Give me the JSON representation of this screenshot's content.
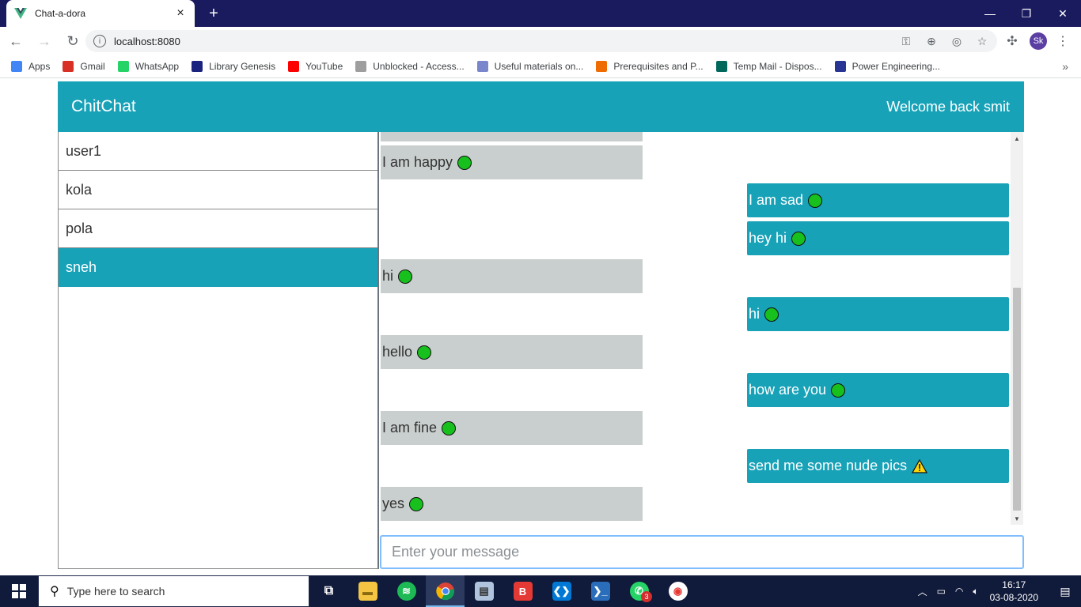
{
  "browser": {
    "tab_title": "Chat-a-dora",
    "url": "localhost:8080",
    "profile_initials": "Sk"
  },
  "bookmarks": [
    {
      "label": "Apps",
      "icon": "apps-grid-icon",
      "color": "#4285f4"
    },
    {
      "label": "Gmail",
      "icon": "gmail-icon",
      "color": "#d93025"
    },
    {
      "label": "WhatsApp",
      "icon": "whatsapp-icon",
      "color": "#25d366"
    },
    {
      "label": "Library Genesis",
      "icon": "library-icon",
      "color": "#1a237e"
    },
    {
      "label": "YouTube",
      "icon": "youtube-icon",
      "color": "#ff0000"
    },
    {
      "label": "Unblocked - Access...",
      "icon": "unblocked-icon",
      "color": "#9e9e9e"
    },
    {
      "label": "Useful materials on...",
      "icon": "materials-icon",
      "color": "#7986cb"
    },
    {
      "label": "Prerequisites and P...",
      "icon": "code-icon",
      "color": "#ef6c00"
    },
    {
      "label": "Temp Mail - Dispos...",
      "icon": "tempmail-icon",
      "color": "#00695c"
    },
    {
      "label": "Power Engineering...",
      "icon": "power-eng-icon",
      "color": "#283593"
    }
  ],
  "app": {
    "brand": "ChitChat",
    "welcome": "Welcome back smit",
    "accent_color": "#17a2b8",
    "users": [
      {
        "name": "user1",
        "active": false
      },
      {
        "name": "kola",
        "active": false
      },
      {
        "name": "pola",
        "active": false
      },
      {
        "name": "sneh",
        "active": true
      }
    ],
    "messages": [
      {
        "text": "I am happy",
        "direction": "received",
        "status": "ok"
      },
      {
        "text": "I am sad",
        "direction": "sent",
        "status": "ok"
      },
      {
        "text": "hey hi",
        "direction": "sent",
        "status": "ok"
      },
      {
        "text": "hi",
        "direction": "received",
        "status": "ok"
      },
      {
        "text": "hi",
        "direction": "sent",
        "status": "ok"
      },
      {
        "text": "hello",
        "direction": "received",
        "status": "ok"
      },
      {
        "text": "how are you",
        "direction": "sent",
        "status": "ok"
      },
      {
        "text": "I am fine",
        "direction": "received",
        "status": "ok"
      },
      {
        "text": "send me some nude pics",
        "direction": "sent",
        "status": "warning"
      },
      {
        "text": "yes",
        "direction": "received",
        "status": "ok"
      }
    ],
    "compose_placeholder": "Enter your message"
  },
  "taskbar": {
    "search_placeholder": "Type here to search",
    "whatsapp_badge": "3",
    "time": "16:17",
    "date": "03-08-2020"
  }
}
